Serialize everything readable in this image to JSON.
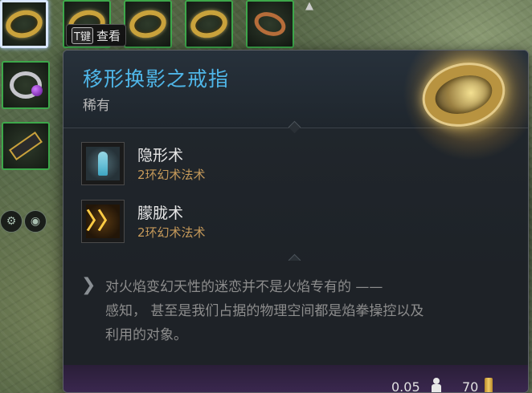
{
  "inventory": {
    "slots": [
      {
        "icon": "gold-ring-icon",
        "selected": true
      },
      {
        "icon": "gold-ring-icon"
      },
      {
        "icon": "gold-ring-icon"
      },
      {
        "icon": "gold-ring-icon"
      },
      {
        "icon": "bronze-ring-icon"
      },
      {
        "icon": "amethyst-ring-icon"
      },
      {
        "icon": "hammer-icon"
      }
    ],
    "inspect_key": "T键",
    "inspect_label": "查看"
  },
  "tooltip": {
    "item_name": "移形换影之戒指",
    "rarity": "稀有",
    "spells": [
      {
        "name": "隐形术",
        "type": "2环幻术法术",
        "icon": "invisibility-spell-icon"
      },
      {
        "name": "朦胧术",
        "type": "2环幻术法术",
        "icon": "blur-spell-icon"
      }
    ],
    "flavor_lines": [
      "对火焰变幻天性的迷恋并不是火焰专有的 ——",
      "感知， 甚至是我们占据的物理空间都是焰拳操控以及",
      "利用的对象。"
    ],
    "weight": "0.05",
    "price": "70"
  },
  "colors": {
    "item_name": "#4fb6e8",
    "spell_type": "#c69a5a",
    "slot_border": "#3da84a"
  }
}
